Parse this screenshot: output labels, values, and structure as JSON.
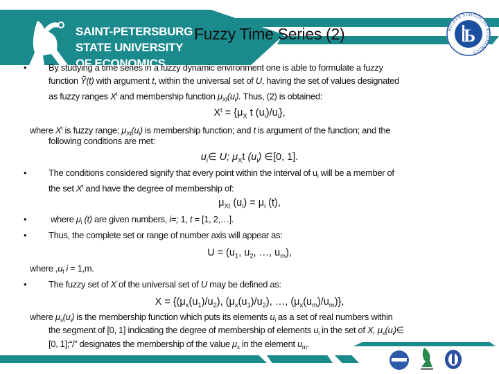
{
  "header": {
    "university_lines": [
      "SAINT-PETERSBURG",
      "STATE UNIVERSITY",
      "OF ECONOMICS"
    ],
    "title": "Fuzzy Time Series (2)",
    "hse_seal_text": "HIGHER SCHOOL OF ECONOMICS",
    "brand_color": "#1a8a8c"
  },
  "body": {
    "lines": [
      {
        "segs": [
          [
            "By studying a time series in a fuzzy dynamic environment one is able to formulate a fuzzy",
            ""
          ]
        ]
      },
      {
        "segs": [
          [
            "function ",
            ""
          ],
          [
            "Ỹ(t)",
            "i"
          ],
          [
            " with argument ",
            ""
          ],
          [
            "t",
            "i"
          ],
          [
            ", within the universal set of ",
            ""
          ],
          [
            "U",
            "i"
          ],
          [
            ", having the set of values designated",
            ""
          ]
        ]
      },
      {
        "segs": [
          [
            "as fuzzy ranges ",
            ""
          ],
          [
            "X",
            "i"
          ],
          [
            "t",
            "sup"
          ],
          [
            " and membership function ",
            ""
          ],
          [
            "μ",
            "i"
          ],
          [
            "Xt",
            "sub"
          ],
          [
            "(u",
            "i"
          ],
          [
            "i",
            "sub"
          ],
          [
            ").",
            "i"
          ],
          [
            " Thus, (2) is obtained:",
            ""
          ]
        ]
      },
      {
        "segs": [
          [
            "X",
            ""
          ],
          [
            "t",
            "sup"
          ],
          [
            " = {μ",
            ""
          ],
          [
            "X",
            "sub"
          ],
          [
            " t (u",
            ""
          ],
          [
            "i",
            "sub"
          ],
          [
            ")/u",
            ""
          ],
          [
            "i",
            "sub"
          ],
          [
            "},",
            ""
          ]
        ]
      },
      {
        "segs": [
          [
            "where ",
            ""
          ],
          [
            "X",
            "i"
          ],
          [
            "t",
            "sup"
          ],
          [
            " is fuzzy range; ",
            ""
          ],
          [
            "μ",
            "i"
          ],
          [
            "Xt",
            "sub"
          ],
          [
            "(u",
            "i"
          ],
          [
            "i",
            "sub"
          ],
          [
            ")",
            "i"
          ],
          [
            " is membership function; and ",
            ""
          ],
          [
            "t",
            "i"
          ],
          [
            " is argument of the function; and the",
            ""
          ]
        ]
      },
      {
        "segs": [
          [
            "following conditions are met:",
            ""
          ]
        ]
      },
      {
        "segs": [
          [
            "u",
            "i"
          ],
          [
            "i",
            "sub"
          ],
          [
            "∈ ",
            ""
          ],
          [
            "U; μ",
            "i"
          ],
          [
            "X",
            "sub"
          ],
          [
            "t ",
            ""
          ],
          [
            "(u",
            "i"
          ],
          [
            "i",
            "sub"
          ],
          [
            ")",
            "i"
          ],
          [
            " ∈[0, 1].",
            ""
          ]
        ]
      },
      {
        "segs": [
          [
            "The conditions considered signify that every point within the interval of u",
            ""
          ],
          [
            "i",
            "sub"
          ],
          [
            " will be a member of",
            ""
          ]
        ]
      },
      {
        "segs": [
          [
            "the set ",
            ""
          ],
          [
            "X",
            "i"
          ],
          [
            "t",
            "sup"
          ],
          [
            " and have the degree of membership of:",
            ""
          ]
        ]
      },
      {
        "segs": [
          [
            "μ",
            ""
          ],
          [
            "Xt",
            "sub"
          ],
          [
            " (u",
            ""
          ],
          [
            "i",
            "sub"
          ],
          [
            ") = μ",
            ""
          ],
          [
            "i",
            "sub"
          ],
          [
            " (t),",
            ""
          ]
        ]
      },
      {
        "segs": [
          [
            " where ",
            ""
          ],
          [
            "μ",
            "i"
          ],
          [
            "i",
            "sub"
          ],
          [
            " (t)",
            "i"
          ],
          [
            " are given numbers, ",
            ""
          ],
          [
            "i=;",
            "i"
          ],
          [
            " 1, ",
            ""
          ],
          [
            "t",
            "i"
          ],
          [
            " = [1, 2,…].",
            ""
          ]
        ]
      },
      {
        "segs": [
          [
            "Thus, the complete set or range of number axis will appear as:",
            ""
          ]
        ]
      },
      {
        "segs": [
          [
            "U = (u",
            ""
          ],
          [
            "1",
            "sub"
          ],
          [
            ", u",
            ""
          ],
          [
            "2",
            "sub"
          ],
          [
            ", …, u",
            ""
          ],
          [
            "m",
            "sub"
          ],
          [
            "),",
            ""
          ]
        ]
      },
      {
        "segs": [
          [
            "where ,",
            ""
          ],
          [
            "u",
            "i"
          ],
          [
            "f",
            "sub"
          ],
          [
            " i",
            "i"
          ],
          [
            " = 1,m.",
            ""
          ]
        ]
      },
      {
        "segs": [
          [
            "The fuzzy set of ",
            ""
          ],
          [
            "X",
            "i"
          ],
          [
            " of the universal set of ",
            ""
          ],
          [
            "U",
            "i"
          ],
          [
            " may be defined as:",
            ""
          ]
        ]
      },
      {
        "segs": [
          [
            "X = {(μ",
            ""
          ],
          [
            "x",
            "sub"
          ],
          [
            "(u",
            ""
          ],
          [
            "1",
            "sub"
          ],
          [
            ")/u",
            ""
          ],
          [
            "2",
            "sub"
          ],
          [
            "), (μ",
            ""
          ],
          [
            "x",
            "sub"
          ],
          [
            "(u",
            ""
          ],
          [
            "1",
            "sub"
          ],
          [
            ")/u",
            ""
          ],
          [
            "2",
            "sub"
          ],
          [
            "), …, (μ",
            ""
          ],
          [
            "x",
            "sub"
          ],
          [
            "(u",
            ""
          ],
          [
            "m",
            "sub"
          ],
          [
            ")/u",
            ""
          ],
          [
            "m",
            "sub"
          ],
          [
            ")},",
            ""
          ]
        ]
      },
      {
        "segs": [
          [
            "where ",
            ""
          ],
          [
            "μ",
            "i"
          ],
          [
            "x",
            "sub"
          ],
          [
            "(u",
            "i"
          ],
          [
            "i",
            "sub"
          ],
          [
            ")",
            "i"
          ],
          [
            " is the membership function which puts its elements ",
            ""
          ],
          [
            "u",
            "i"
          ],
          [
            "i",
            "sub"
          ],
          [
            " as a set of real numbers within",
            ""
          ]
        ]
      },
      {
        "segs": [
          [
            "the segment of [0, 1] indicating the degree of membership of elements ",
            ""
          ],
          [
            "u",
            "i"
          ],
          [
            "i",
            "sub"
          ],
          [
            " in the set of ",
            ""
          ],
          [
            "X, μ",
            "i"
          ],
          [
            "x",
            "sub"
          ],
          [
            "(u",
            "i"
          ],
          [
            "i",
            "sub"
          ],
          [
            ")",
            "i"
          ],
          [
            "∈",
            ""
          ]
        ]
      },
      {
        "segs": [
          [
            "[0, 1];“/” designates the membership of the value ",
            ""
          ],
          [
            "μ",
            "i"
          ],
          [
            "x",
            "sub"
          ],
          [
            " in the element ",
            ""
          ],
          [
            "u",
            "i"
          ],
          [
            "m",
            "sub"
          ],
          [
            ".",
            ""
          ]
        ]
      }
    ],
    "bullet": "•"
  },
  "footer": {
    "logos": [
      "ENGECON",
      "FINEC",
      "university-emblem"
    ]
  }
}
